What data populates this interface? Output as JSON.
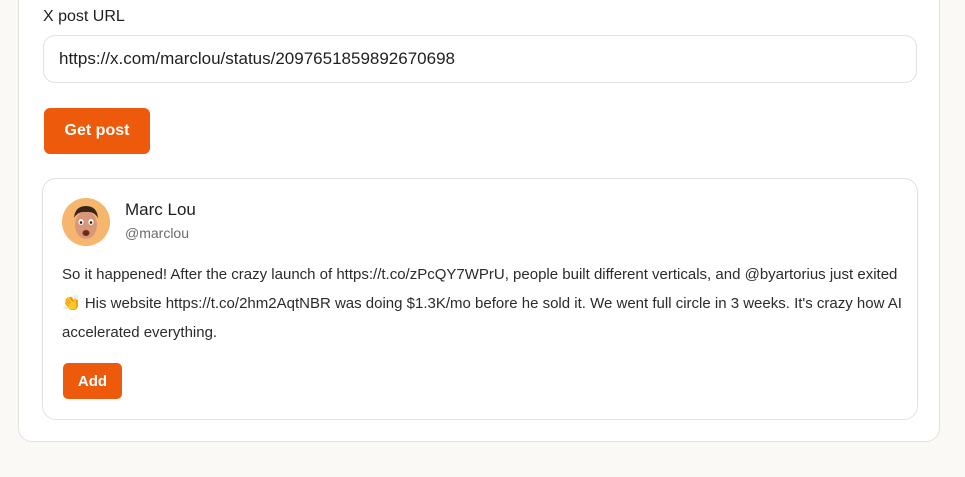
{
  "form": {
    "label": "X post URL",
    "url_value": "https://x.com/marclou/status/2097651859892670698",
    "submit_label": "Get post"
  },
  "post": {
    "author_name": "Marc Lou",
    "author_handle": "@marclou",
    "text": "So it happened! After the crazy launch of https://t.co/zPcQY7WPrU, people built different verticals, and @byartorius just exited 👏 His website https://t.co/2hm2AqtNBR was doing $1.3K/mo before he sold it. We went full circle in 3 weeks. It's crazy how AI accelerated everything.",
    "add_label": "Add",
    "avatar_icon": "avatar-photo"
  },
  "colors": {
    "accent": "#ee5a0b",
    "page_background": "#fbf9f6",
    "border": "#e4e1dc"
  }
}
